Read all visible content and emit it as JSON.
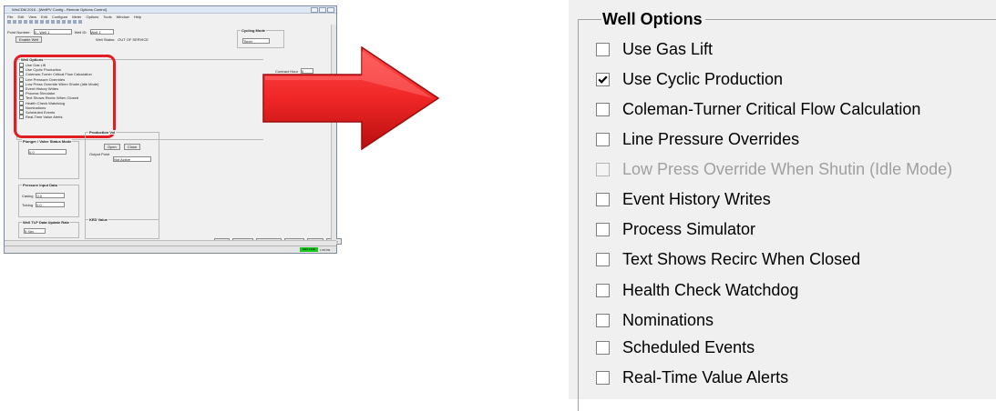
{
  "thumbnail": {
    "title": "WinCDM 2016 - [WellPV Config - Remote Options Control]",
    "menu": [
      "File",
      "Edit",
      "View",
      "Edit",
      "Configure",
      "Meter",
      "Options",
      "Tools",
      "Window",
      "Help"
    ],
    "point_number_label": "Point Number:",
    "point_number_value": "0 - Well 1",
    "well_id_label": "Well ID:",
    "well_id_value": "Well 1",
    "enable_well_label": "Enable Well",
    "well_status_label": "Well Status:",
    "well_status_value": "OUT OF SERVICE",
    "cycling_mode_label": "Cycling Mode",
    "cycling_mode_value": "Timer",
    "well_options_label": "Well Options",
    "options": [
      "Use Gas Lift",
      "Use Cyclic Production",
      "Coleman-Turner Critical Flow Calculation",
      "Line Pressure Overrides",
      "Low Press Override When Shutin (Idle Mode)",
      "Event History Writes",
      "Process Simulator",
      "Text Shows Recirc When Closed",
      "Health Check Watchdog",
      "Nominations",
      "Scheduled Events",
      "Real-Time Value Alerts"
    ],
    "contract_hour_label": "Contract Hour",
    "contract_hour_value": "0",
    "plunger_group_label": "Plunger / Valve Status Mode",
    "production_group_label": "Production Vol",
    "pressure_group_label": "Pressure Input Data",
    "casing_label": "Casing",
    "tubing_label": "Tubing",
    "value_zero": "0.0",
    "tlp_group_label": "Well TLP Data Update Rate",
    "tlp_value": "5 Sec",
    "open_label": "Open",
    "close_label": "Close",
    "output_label": "Output Point",
    "not_active": "Not Active",
    "kd_group_label": "KED Value",
    "footer_buttons": [
      "Save",
      "Save As",
      "Undo/Redo",
      "Refresh",
      "Close",
      "Help"
    ],
    "copyright": "Copyright Protected 1996-2016 by Ferguson Beauregard / Logic Controls Company, LP",
    "status_green": "DEV LINE",
    "status_time": "1:58 PM"
  },
  "zoom": {
    "group_title": "Well Options",
    "options": [
      {
        "label": "Use Gas Lift",
        "checked": false,
        "enabled": true
      },
      {
        "label": "Use Cyclic Production",
        "checked": true,
        "enabled": true
      },
      {
        "label": "Coleman-Turner Critical Flow Calculation",
        "checked": false,
        "enabled": true
      },
      {
        "label": "Line Pressure Overrides",
        "checked": false,
        "enabled": true
      },
      {
        "label": "Low Press Override When Shutin (Idle Mode)",
        "checked": false,
        "enabled": false
      },
      {
        "label": "Event History Writes",
        "checked": false,
        "enabled": true
      },
      {
        "label": "Process Simulator",
        "checked": false,
        "enabled": true
      },
      {
        "label": "Text Shows Recirc When Closed",
        "checked": false,
        "enabled": true
      },
      {
        "label": "Health Check Watchdog",
        "checked": false,
        "enabled": true
      },
      {
        "label": "Nominations",
        "checked": false,
        "enabled": true
      },
      {
        "label": "Scheduled Events",
        "checked": false,
        "enabled": true
      },
      {
        "label": "Real-Time Value Alerts",
        "checked": false,
        "enabled": true
      }
    ]
  },
  "colors": {
    "highlight": "#e21d23",
    "arrow_top": "#ff3a3a",
    "arrow_bottom": "#c41010",
    "status_green": "#18c91d"
  }
}
